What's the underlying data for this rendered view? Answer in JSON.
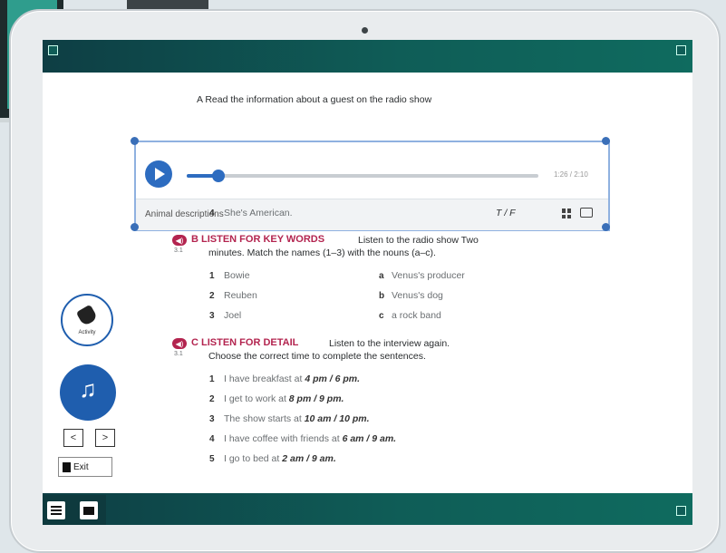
{
  "exercise_a": {
    "heading": "A  Read the information about a guest on the radio show",
    "item4_num": "4",
    "item4_text": "She's American.",
    "item4_answer": "T / F"
  },
  "audio_player": {
    "time": "1:26 / 2:10",
    "progress": 0.09,
    "caption": "Animal descriptions"
  },
  "exercise_b": {
    "track": "3.1",
    "heading": "B  LISTEN FOR KEY WORDS",
    "instruction_1": "Listen to the radio show Two",
    "instruction_2": "minutes. Match the names (1–3) with the nouns (a–c).",
    "names": [
      {
        "num": "1",
        "text": "Bowie"
      },
      {
        "num": "2",
        "text": "Reuben"
      },
      {
        "num": "3",
        "text": "Joel"
      }
    ],
    "nouns": [
      {
        "letter": "a",
        "text": "Venus's producer"
      },
      {
        "letter": "b",
        "text": "Venus's dog"
      },
      {
        "letter": "c",
        "text": "a rock band"
      }
    ]
  },
  "exercise_c": {
    "track": "3.1",
    "heading": "C  LISTEN FOR DETAIL",
    "instruction_1": "Listen to the interview again.",
    "instruction_2": "Choose the correct time to complete the sentences.",
    "items": [
      {
        "num": "1",
        "text": "I have breakfast at ",
        "choice": "4 pm / 6 pm."
      },
      {
        "num": "2",
        "text": "I get to work at ",
        "choice": "8 pm / 9 pm."
      },
      {
        "num": "3",
        "text": "The show starts at ",
        "choice": "10 am / 10 pm."
      },
      {
        "num": "4",
        "text": "I have coffee with friends at ",
        "choice": "6 am / 9 am."
      },
      {
        "num": "5",
        "text": "I go to bed at ",
        "choice": "2 am / 9 am."
      }
    ]
  },
  "sidebar": {
    "activity_label": "Activity",
    "prev": "<",
    "next": ">",
    "exit_label": "Exit"
  }
}
